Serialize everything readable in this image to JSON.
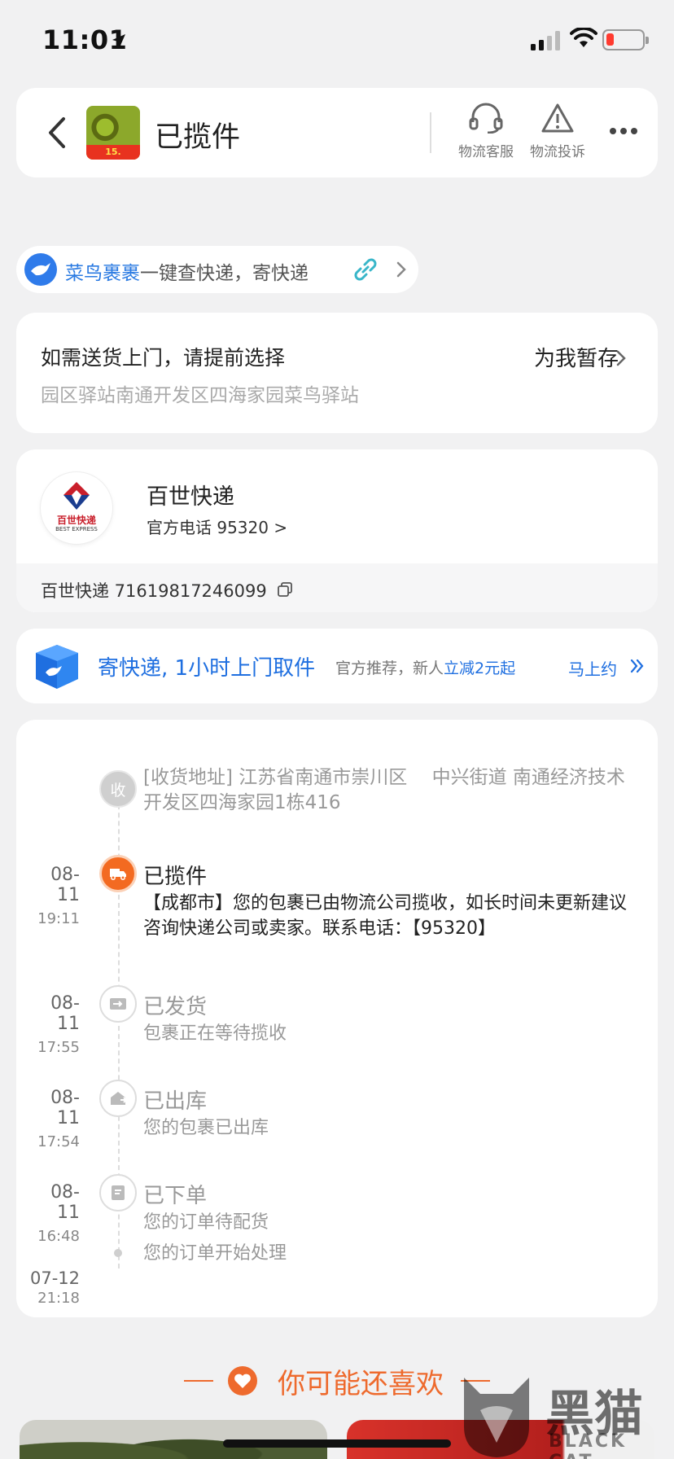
{
  "status_bar": {
    "time": "11:01"
  },
  "header": {
    "title": "已揽件",
    "thumb_tag": "15.",
    "actions": [
      {
        "label": "物流客服",
        "icon": "headset-icon"
      },
      {
        "label": "物流投诉",
        "icon": "warning-icon"
      }
    ]
  },
  "cainiao": {
    "brand": "菜鸟裹裹",
    "text": "一键查快递，寄快递"
  },
  "delivery": {
    "title": "如需送货上门，请提前选择",
    "location": "园区驿站南通开发区四海家园菜鸟驿站",
    "action": "为我暂存"
  },
  "courier": {
    "name": "百世快递",
    "phone": "官方电话 95320 >",
    "tracking": "百世快递 71619817246099",
    "logo_cn": "百世快递",
    "logo_en": "BEST EXPRESS"
  },
  "promo": {
    "main": "寄快递, 1小时上门取件",
    "sub_prefix": "官方推荐，新人",
    "sub_highlight": "立减2元起",
    "cta": "马上约"
  },
  "timeline": {
    "receive_label": "收",
    "receive_address": "[收货地址] 江苏省南通市崇川区　 中兴街道 南通经济技术开发区四海家园1栋416",
    "events": [
      {
        "date": "08-11",
        "time": "19:11",
        "title": "已揽件",
        "desc": "【成都市】您的包裹已由物流公司揽收，如长时间未更新建议咨询快递公司或卖家。联系电话：【95320】",
        "icon": "truck-icon",
        "active": true
      },
      {
        "date": "08-11",
        "time": "17:55",
        "title": "已发货",
        "desc": "包裹正在等待揽收",
        "icon": "shipped-icon",
        "active": false
      },
      {
        "date": "08-11",
        "time": "17:54",
        "title": "已出库",
        "desc": "您的包裹已出库",
        "icon": "warehouse-icon",
        "active": false
      },
      {
        "date": "08-11",
        "time": "16:48",
        "title": "已下单",
        "desc": "您的订单待配货",
        "icon": "order-icon",
        "active": false
      },
      {
        "date": "07-12",
        "time": "21:18",
        "title": "",
        "desc": "您的订单开始处理",
        "icon": "dot",
        "active": false
      }
    ]
  },
  "recommend": {
    "title": "你可能还喜欢"
  },
  "watermark": {
    "cn": "黑猫",
    "en": "BLACK CAT"
  },
  "colors": {
    "accent_orange": "#f36a21",
    "accent_blue": "#1f6fe0",
    "background": "#f1f1f2"
  }
}
